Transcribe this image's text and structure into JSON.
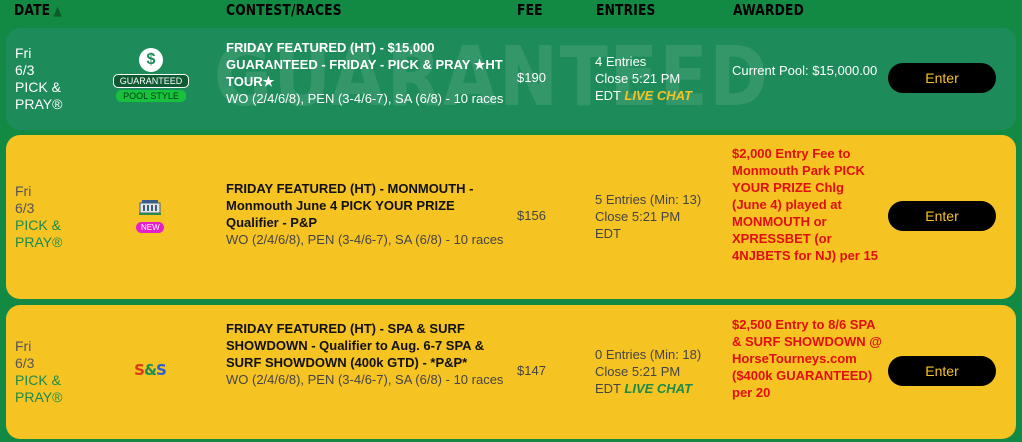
{
  "header": {
    "date_label": "DATE",
    "contest_label": "CONTEST/RACES",
    "fee_label": "FEE",
    "entries_label": "ENTRIES",
    "awarded_label": "AWARDED",
    "sort_icon": "triangle-up-icon"
  },
  "rows": [
    {
      "day": "Fri",
      "date": "6/3",
      "brand": "PICK & PRAY®",
      "watermark": "GUARANTEED",
      "icon": "dollar-icon",
      "badge1": "GUARANTEED",
      "badge2": "POOL STYLE",
      "title": "FRIDAY FEATURED (HT) - $15,000 GUARANTEED - FRIDAY - PICK & PRAY ★HT TOUR★",
      "races": "WO (2/4/6/8), PEN (3-4/6-7), SA (6/8) - 10 races",
      "fee": "$190",
      "entries": "4 Entries",
      "close": "Close 5:21 PM",
      "tz": "EDT",
      "live_chat": "LIVE CHAT",
      "awarded": "Current Pool: $15,000.00",
      "button": "Enter"
    },
    {
      "day": "Fri",
      "date": "6/3",
      "brand": "PICK & PRAY®",
      "icon": "monmouth-logo-icon",
      "badge": "NEW",
      "title": "FRIDAY FEATURED (HT) - MONMOUTH - Monmouth June 4 PICK YOUR PRIZE Qualifier - P&P",
      "races": "WO (2/4/6/8), PEN (3-4/6-7), SA (6/8) - 10 races",
      "fee": "$156",
      "entries": "5 Entries (Min: 13)",
      "close": "Close 5:21 PM",
      "tz": "EDT",
      "awarded": "$2,000 Entry Fee to Monmouth Park PICK YOUR PRIZE Chlg (June 4) played at MONMOUTH or XPRESSBET (or 4NJBETS for NJ) per 15",
      "button": "Enter"
    },
    {
      "day": "Fri",
      "date": "6/3",
      "brand": "PICK & PRAY®",
      "icon": "spa-surf-logo-icon",
      "logo_s1": "S",
      "logo_amp": "&",
      "logo_s2": "S",
      "title": "FRIDAY FEATURED (HT) - SPA & SURF SHOWDOWN - Qualifier to Aug. 6-7 SPA & SURF SHOWDOWN (400k GTD) - *P&P*",
      "races": "WO (2/4/6/8), PEN (3-4/6-7), SA (6/8) - 10 races",
      "fee": "$147",
      "entries": "0 Entries (Min: 18)",
      "close": "Close 5:21 PM",
      "tz": "EDT",
      "live_chat": "LIVE CHAT",
      "awarded": "$2,500 Entry to 8/6 SPA & SURF SHOWDOWN @ HorseTourneys.com ($400k GUARANTEED) per 20",
      "button": "Enter"
    }
  ],
  "colors": {
    "page_bg": "#138a43",
    "guaranteed_row": "#1d8c5a",
    "standard_row": "#f5c322",
    "button_bg": "#000000",
    "button_text": "#f5c322",
    "award_red": "#e01010"
  }
}
